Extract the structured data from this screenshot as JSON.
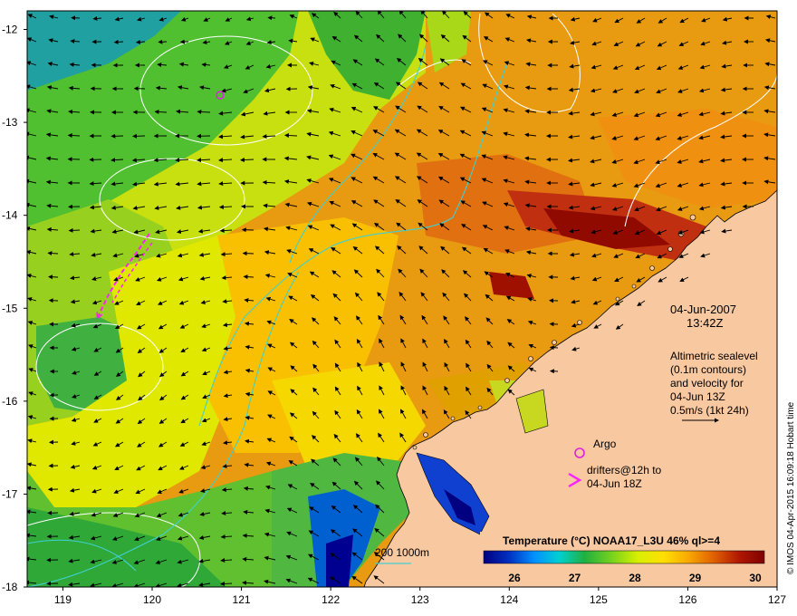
{
  "map": {
    "lon_ticks": [
      "119",
      "120",
      "121",
      "122",
      "123",
      "124",
      "125",
      "126",
      "127"
    ],
    "lat_ticks": [
      "-12",
      "-13",
      "-14",
      "-15",
      "-16",
      "-17",
      "-18"
    ],
    "lon_range": [
      118.6,
      127.0
    ],
    "lat_range": [
      -18.0,
      -11.8
    ]
  },
  "labels": {
    "date": "04-Jun-2007",
    "time": "13:42Z",
    "altimetry_lines": [
      "Altimetric sealevel",
      "(0.1m contours)",
      "and velocity for",
      "04-Jun 13Z",
      "0.5m/s (1kt 24h)"
    ],
    "argo": "Argo",
    "drifters_line1": "drifters@12h to",
    "drifters_line2": "04-Jun 18Z",
    "depth_contours": "200  1000m",
    "credit": "© IMOS 04-Apr-2015 16:09:18 Hobart time"
  },
  "colorbar": {
    "title": "Temperature (°C) NOAA17_L3U 46% ql>=4",
    "ticks": [
      "26",
      "27",
      "28",
      "29",
      "30"
    ],
    "colors": [
      "#000080",
      "#0030c0",
      "#0090ff",
      "#00d0d0",
      "#20b040",
      "#70d020",
      "#d8f000",
      "#ffe000",
      "#f8a800",
      "#e06000",
      "#b01800",
      "#800000"
    ]
  },
  "colors": {
    "land": "#f8c8a0",
    "argo_marker": "#e020e0",
    "drifter": "#ff20ff",
    "isobath": "#40d0d0",
    "contour": "#ffffff"
  }
}
